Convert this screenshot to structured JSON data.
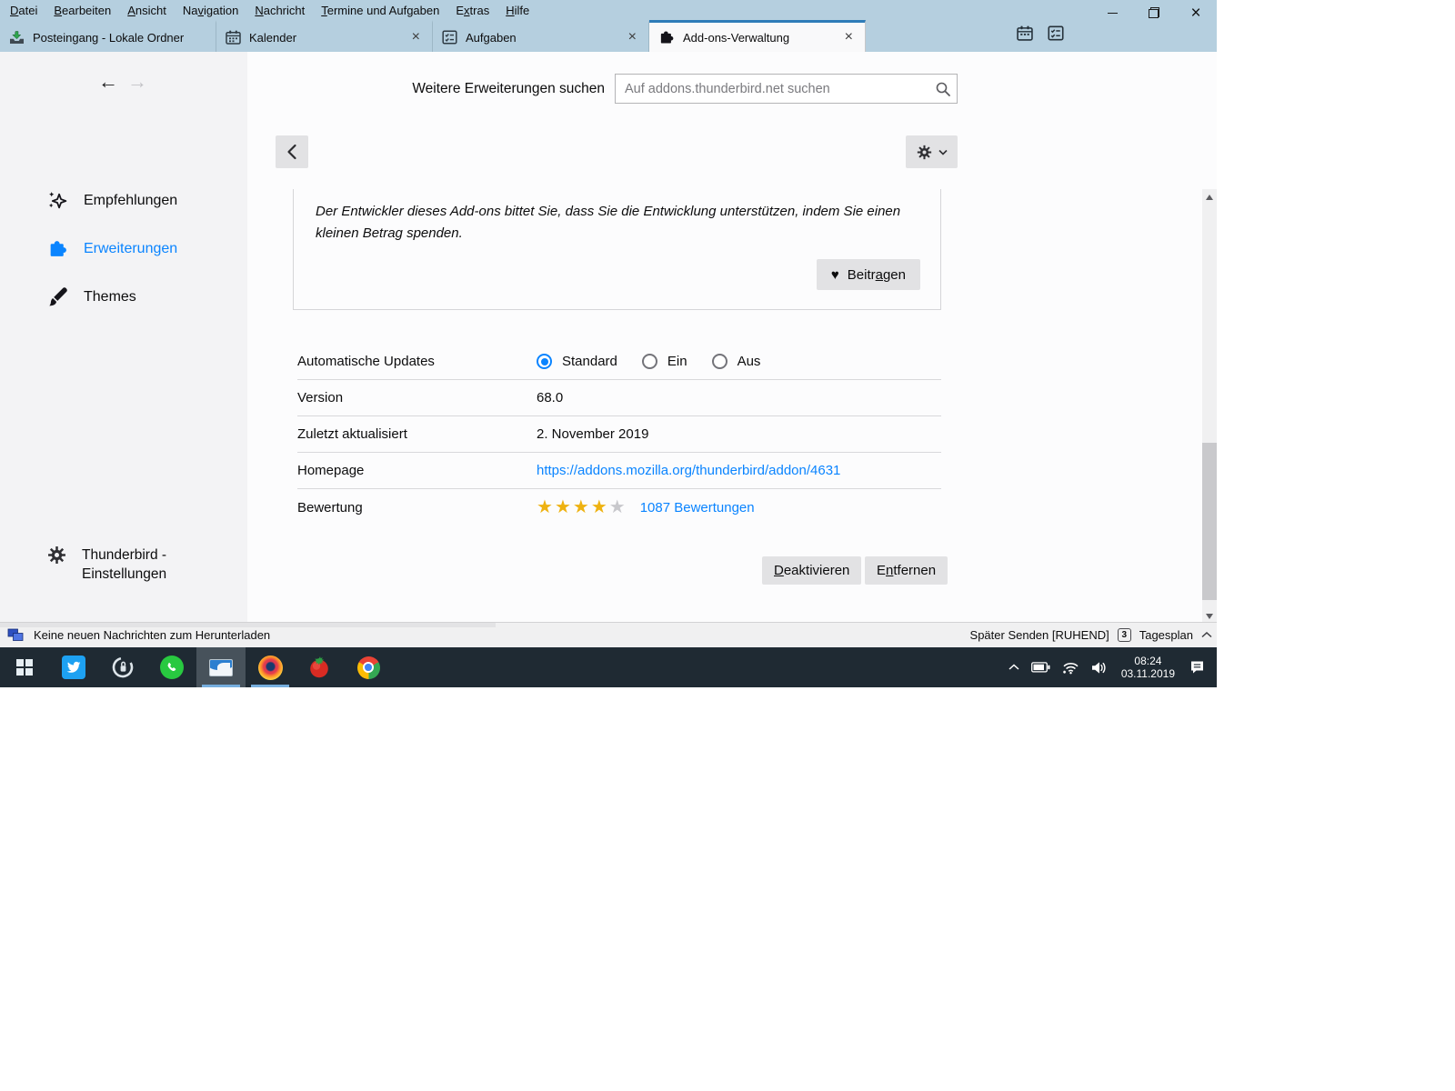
{
  "colors": {
    "titlebar_bg": "#b5cfdf",
    "tab_accent": "#2e7cb8",
    "accent_blue": "#0a84ff",
    "link_blue": "#0a84ff",
    "star_gold": "#eeb211",
    "taskbar_bg": "#1f2a33"
  },
  "icons": {
    "star": "★",
    "heart": "♥",
    "back_arrow": "←",
    "forward_arrow": "→",
    "close": "×"
  },
  "menu_bar": {
    "items": [
      {
        "label": "Datei",
        "key": "D"
      },
      {
        "label": "Bearbeiten",
        "key": "B"
      },
      {
        "label": "Ansicht",
        "key": "A"
      },
      {
        "label": "Navigation",
        "key": "v"
      },
      {
        "label": "Nachricht",
        "key": "N"
      },
      {
        "label": "Termine und Aufgaben",
        "key": "T"
      },
      {
        "label": "Extras",
        "key": "x"
      },
      {
        "label": "Hilfe",
        "key": "H"
      }
    ]
  },
  "tabs": {
    "items": [
      {
        "label": "Posteingang - Lokale Ordner"
      },
      {
        "label": "Kalender"
      },
      {
        "label": "Aufgaben"
      },
      {
        "label": "Add-ons-Verwaltung"
      }
    ]
  },
  "sidebar": {
    "items": [
      {
        "label": "Empfehlungen"
      },
      {
        "label": "Erweiterungen"
      },
      {
        "label": "Themes"
      }
    ],
    "settings_label": "Thunderbird - Einstellungen"
  },
  "header": {
    "search_label": "Weitere Erweiterungen suchen",
    "search_placeholder": "Auf addons.thunderbird.net suchen"
  },
  "addon": {
    "dev_note": "Der Entwickler dieses Add-ons bittet Sie, dass Sie die Entwicklung unterstützen, indem Sie einen kleinen Betrag spenden.",
    "contribute": {
      "label": "Beitragen",
      "key": "a"
    },
    "details": {
      "auto_updates": {
        "label": "Automatische Updates",
        "options": [
          "Standard",
          "Ein",
          "Aus"
        ],
        "selected": 0
      },
      "version": {
        "label": "Version",
        "value": "68.0"
      },
      "last_updated": {
        "label": "Zuletzt aktualisiert",
        "value": "2. November 2019"
      },
      "homepage": {
        "label": "Homepage",
        "value": "https://addons.mozilla.org/thunderbird/addon/4631"
      },
      "rating": {
        "label": "Bewertung",
        "stars": 4,
        "max": 5,
        "link": "1087 Bewertungen"
      }
    },
    "actions": {
      "deactivate": {
        "label": "Deaktivieren",
        "key": "D"
      },
      "remove": {
        "label": "Entfernen",
        "key": "n"
      }
    }
  },
  "statusbar": {
    "message": "Keine neuen Nachrichten zum Herunterladen",
    "later_send": "Später Senden [RUHEND]",
    "today_badge": "3",
    "today_label": "Tagesplan"
  },
  "taskbar": {
    "clock_time": "08:24",
    "clock_date": "03.11.2019"
  }
}
